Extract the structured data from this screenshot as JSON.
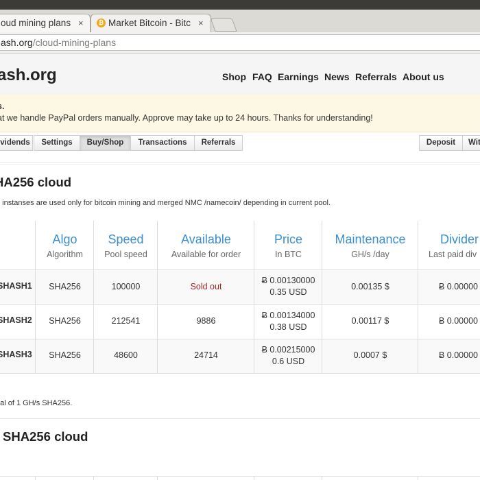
{
  "browser": {
    "tabs": [
      {
        "title": "oud mining plans",
        "active": true
      },
      {
        "title": "Market Bitcoin - Bitc",
        "active": false
      }
    ],
    "close_glyph": "×",
    "url_domain": "ash.org",
    "url_path": "/cloud-mining-plans"
  },
  "site": {
    "brand": "ash.org",
    "nav": [
      "Shop",
      "FAQ",
      "Earnings",
      "News",
      "Referrals",
      "About us"
    ]
  },
  "alert": {
    "title": "s.",
    "text": "at we handle PayPal orders manually. Approve may take up to 24 hours. Thanks for understanding!",
    "color": "#fcf8e3"
  },
  "subnav": {
    "left": [
      "vidends",
      "Settings",
      "Buy/Shop",
      "Transactions",
      "Referrals"
    ],
    "active": "Buy/Shop",
    "right": [
      "Deposit",
      "Wit"
    ]
  },
  "section1": {
    "title": "HA256 cloud",
    "description": "d instanses are used only for bitcoin mining and merged NMC /namecoin/ depending in current pool."
  },
  "table": {
    "headers": [
      {
        "title": "Algo",
        "sub": "Algorithm"
      },
      {
        "title": "Speed",
        "sub": "Pool speed"
      },
      {
        "title": "Available",
        "sub": "Available for order"
      },
      {
        "title": "Price",
        "sub": "In BTC"
      },
      {
        "title": "Maintenance",
        "sub": "GH/s /day"
      },
      {
        "title": "Divider",
        "sub": "Last paid div"
      }
    ],
    "header_color": "#3b8fd0",
    "rows": [
      {
        "name": "SHASH1",
        "algo": "SHA256",
        "speed": "100000",
        "available": "Sold out",
        "price_btc": "Ƀ 0.00130000",
        "price_usd": "0.35 USD",
        "maintenance": "0.00135 $",
        "dividend": "Ƀ 0.00000"
      },
      {
        "name": "SHASH2",
        "algo": "SHA256",
        "speed": "212541",
        "available": "9886",
        "price_btc": "Ƀ 0.00134000",
        "price_usd": "0.38 USD",
        "maintenance": "0.00117 $",
        "dividend": "Ƀ 0.00000"
      },
      {
        "name": "SHASH3",
        "algo": "SHA256",
        "speed": "48600",
        "available": "24714",
        "price_btc": "Ƀ 0.00215000",
        "price_usd": "0.6 USD",
        "maintenance": "0.0007 $",
        "dividend": "Ƀ 0.00000"
      }
    ],
    "soldout_color": "#a42323"
  },
  "note": "ual of 1 GH/s SHA256.",
  "section2": {
    "title": "SHA256 cloud"
  }
}
